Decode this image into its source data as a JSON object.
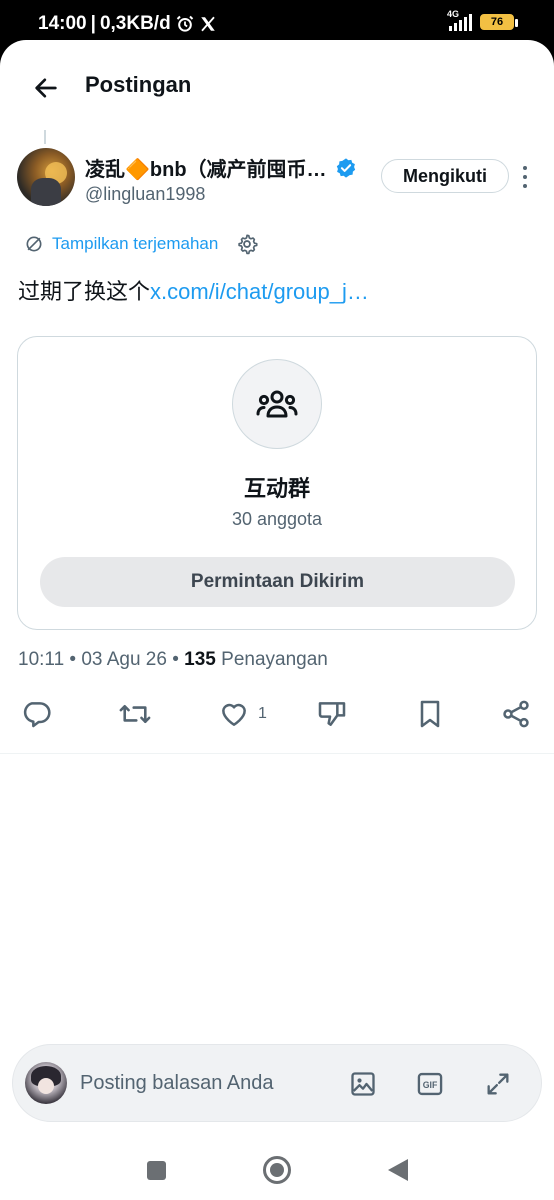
{
  "status_bar": {
    "time": "14:00",
    "separator": "|",
    "net_speed": "0,3KB/d",
    "network_type": "4G",
    "battery_level": "76",
    "icons": [
      "alarm-icon",
      "x-logo-icon",
      "signal-icon",
      "battery-icon"
    ]
  },
  "header": {
    "title": "Postingan",
    "back_icon": "arrow-left-icon"
  },
  "author": {
    "display_name": "凌乱🔶bnb（减产前囤币…",
    "handle": "@lingluan1998",
    "verified": true,
    "follow_label": "Mengikuti"
  },
  "translate": {
    "label": "Tampilkan terjemahan"
  },
  "post": {
    "text": "过期了换这个",
    "link": "x.com/i/chat/group_j…"
  },
  "card": {
    "group_name": "互动群",
    "members": "30 anggota",
    "request_label": "Permintaan Dikirim"
  },
  "meta": {
    "time": "10:11",
    "date": "03 Agu 26",
    "separator": "•",
    "views_count": "135",
    "views_label": "Penayangan"
  },
  "actions": {
    "like_count": "1"
  },
  "reply": {
    "placeholder": "Posting balasan Anda"
  },
  "colors": {
    "accent": "#1d9bf0",
    "text": "#0f1419",
    "muted": "#536471",
    "border": "#cfd9de"
  }
}
